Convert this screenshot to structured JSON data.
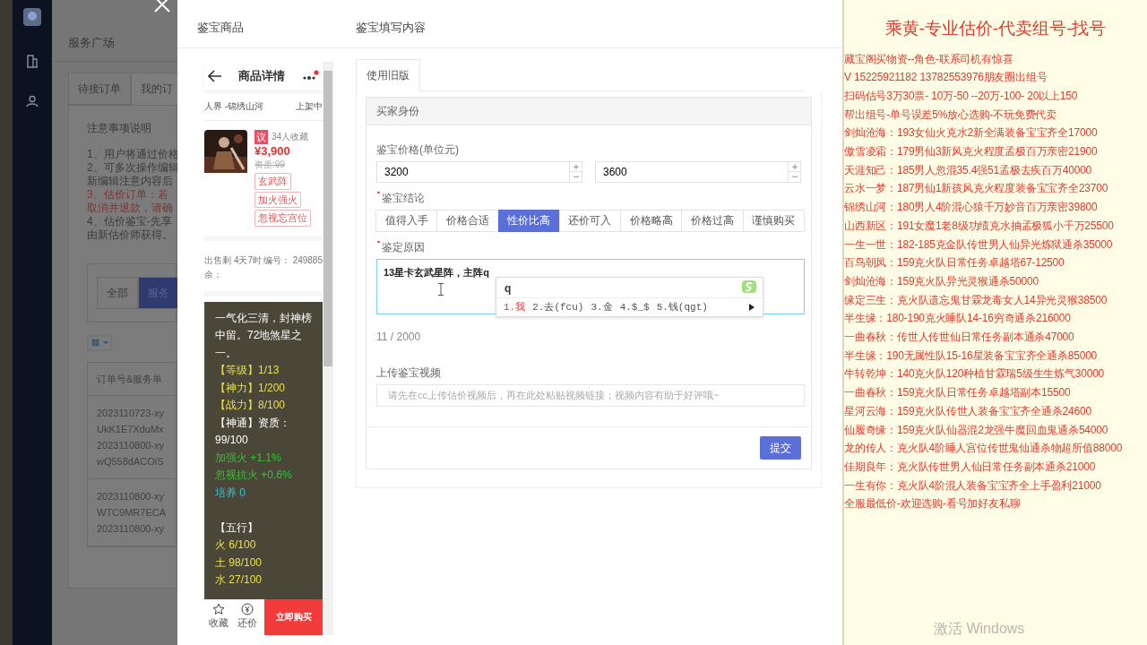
{
  "background_page": {
    "title": "服务广场",
    "tabs": [
      {
        "label": "待接订单",
        "selected": false
      },
      {
        "label": "我的订",
        "selected": true
      }
    ],
    "notice": {
      "title": "注意事项说明",
      "lines": [
        {
          "text": "1、用户将通过价格",
          "kind": "normal"
        },
        {
          "text": "2、可多次操作编辑",
          "kind": "normal"
        },
        {
          "text": "新编辑注意内容后",
          "kind": "normal"
        },
        {
          "text": "3、估价订单：若",
          "kind": "warning"
        },
        {
          "text": "取消并退款，请确",
          "kind": "warning"
        },
        {
          "text": "4、估价鉴宝-先享",
          "kind": "normal"
        },
        {
          "text": "由新估价师获得。",
          "kind": "normal"
        }
      ]
    },
    "filters": [
      {
        "label": "全部",
        "selected": false
      },
      {
        "label": "服务",
        "selected": true
      }
    ],
    "table": {
      "columns": [
        "订单号&服务单"
      ],
      "rows": [
        [
          "2023110723-xy",
          "UkK1E7XduMx",
          "2023110800-xy",
          "wQ558dACOiS"
        ],
        [
          "2023110800-xy",
          "WTC9MR7ECA",
          "2023110800-xy"
        ]
      ]
    }
  },
  "modal": {
    "product_title": "鉴宝商品",
    "phone": {
      "title": "商品详情",
      "server": "人界 -锦绣山河",
      "status": "上架中",
      "badge": "议",
      "favorites": "34人收藏",
      "price": "¥3,900",
      "qualification": "资质:99",
      "tags": [
        "玄武阵",
        "加火强火",
        "忽视忘宫位"
      ],
      "meta": [
        {
          "label": "出售剩余：",
          "value": "4天7时"
        },
        {
          "label": "编号：",
          "value": "249885"
        }
      ],
      "description": [
        {
          "text": "一气化三清，封神榜中留。72地煞星之一。",
          "kind": "text"
        },
        {
          "text": "【等级】1/13",
          "kind": "stat"
        },
        {
          "text": "【神力】1/200",
          "kind": "stat"
        },
        {
          "text": "【战力】8/100",
          "kind": "stat"
        },
        {
          "text": "【神通】资质：99/100",
          "kind": "text"
        },
        {
          "text": "加强火 +1.1%",
          "kind": "bonus"
        },
        {
          "text": "忽视抗火 +0.6%",
          "kind": "bonus"
        },
        {
          "text": "培养 0",
          "kind": "training"
        },
        {
          "text": "【五行】",
          "kind": "heading"
        },
        {
          "text": "火 6/100",
          "kind": "stat"
        },
        {
          "text": "土 98/100",
          "kind": "stat"
        },
        {
          "text": "水 27/100",
          "kind": "stat"
        }
      ],
      "actions": [
        {
          "label": "收藏",
          "kind": "favorite"
        },
        {
          "label": "还价",
          "kind": "bargain"
        }
      ],
      "buy_button": "立即购买"
    },
    "form_title": "鉴宝填写内容",
    "tabs": [
      {
        "label": "使用旧版",
        "selected": true
      }
    ],
    "card_header": "买家身份",
    "price_label": "鉴宝价格(单位元)",
    "prices": [
      "3200",
      "3600"
    ],
    "conclusion_label": "鉴宝结论",
    "conclusions": [
      {
        "label": "值得入手",
        "selected": false
      },
      {
        "label": "价格合适",
        "selected": false
      },
      {
        "label": "性价比高",
        "selected": true
      },
      {
        "label": "还价可入",
        "selected": false
      },
      {
        "label": "价格略高",
        "selected": false
      },
      {
        "label": "价格过高",
        "selected": false
      },
      {
        "label": "谨慎购买",
        "selected": false
      }
    ],
    "reason_label": "鉴定原因",
    "reason": "13星卡玄武星阵，主阵q",
    "ime": {
      "input": "q",
      "candidates": [
        {
          "label": "1.我",
          "selected": true
        },
        {
          "label": "2.去(fcu)",
          "selected": false
        },
        {
          "label": "3.金",
          "selected": false
        },
        {
          "label": "4.$_$",
          "selected": false
        },
        {
          "label": "5.钱(qgt)",
          "selected": false
        }
      ]
    },
    "char_count": "11 / 2000",
    "video_label": "上传鉴宝视频",
    "video_placeholder": "请先在cc上传估价视频后，再在此处粘贴视频链接；视频内容有助于好评哦~",
    "submit": "提交"
  },
  "ad_panel": {
    "title": "乘黄-专业估价-代卖组号-找号",
    "lines": [
      "藏宝阁买物资--角色-联系司机有惊喜",
      "V 15225921182  13782553976朋友圈出组号",
      "扫码估号3万30票- 10万-50 --20万-100- 20以上150",
      "帮出组号-单号误差5%放心选购-不玩免费代卖",
      "剑灿沧海：193女仙火克水2新全满装备宝宝齐全17000",
      "傲雪凌霜：179男仙3新风克火程度孟极百万亲密21900",
      "天涯知己：185男人忽混35.4强51孟极去疾百万40000",
      "云水一梦：187男仙1新孩风克火程度装备宝宝齐全23700",
      "锦绣山河：180男人4阶混心猿千万妙音百万亲密39800",
      "山西新区：191女魔1老8级功绩克水抽孟极狐小千万25500",
      "一生一世：182-185克金队传世男人仙异光炼狱通杀35000",
      "百鸟朝凤：159克火队日常任务卓越塔67-12500",
      "剑灿沧海：159克火队异光灵猴通杀50000",
      "缘定三生：克火队遗忘鬼甘霖龙毒女人14异光灵猴38500",
      "半生缘：180-190克火睡队14-16穷奇通杀216000",
      "一曲春秋：传世人传世仙日常任务副本通杀47000",
      "半生缘：190无属性队15-16星装备宝宝齐全通杀85000",
      "牛转乾坤：140克火队120种植甘霖瑞5级生生炼气30000",
      "一曲春秋：159克火队日常任务卓越塔副本15500",
      "星河云海：159克火队传世人装备宝宝齐全通杀24600",
      "仙履奇缘：159克火队仙器混2龙强牛魔回血鬼通杀54000",
      "龙的传人：克火队4阶睡人宫位传世鬼仙通杀物超所值88000",
      "佳期良年：克火队传世男人仙日常任务副本通杀21000",
      "一生有你：克火队4阶混人装备宝宝齐全上手盈利21000",
      "全服最低价-欢迎选购-看号加好友私聊"
    ]
  },
  "os_notice": "激活 Windows"
}
